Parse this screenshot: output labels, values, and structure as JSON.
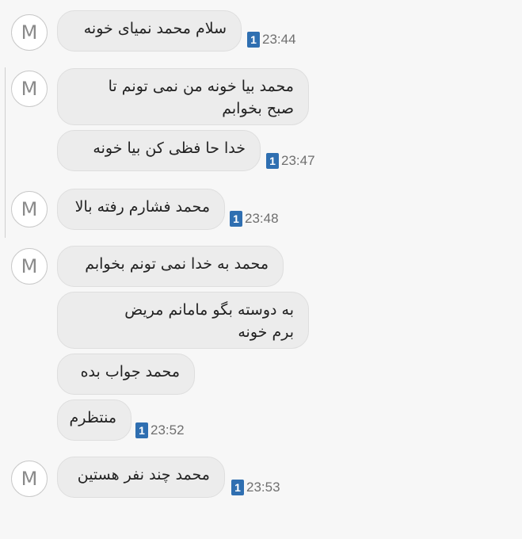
{
  "conversation": {
    "avatar_letter": "M",
    "messages": [
      {
        "text": "سلام محمد نمیای خونه",
        "badge": "1",
        "time": "23:44"
      },
      {
        "text": "محمد بیا خونه من نمی تونم تا\nصبح بخوابم"
      },
      {
        "text": "خدا حا فظی کن بیا خونه",
        "badge": "1",
        "time": "23:47"
      },
      {
        "text": "محمد فشارم رفته بالا",
        "badge": "1",
        "time": "23:48"
      },
      {
        "text": "محمد به خدا نمی تونم بخوابم"
      },
      {
        "text": "به دوسته بگو مامانم مریض\nبرم خونه"
      },
      {
        "text": "محمد جواب بده"
      },
      {
        "text": "منتظرم",
        "badge": "1",
        "time": "23:52"
      },
      {
        "text": "محمد چند نفر هستین",
        "badge": "1",
        "time": "23:53"
      }
    ]
  }
}
